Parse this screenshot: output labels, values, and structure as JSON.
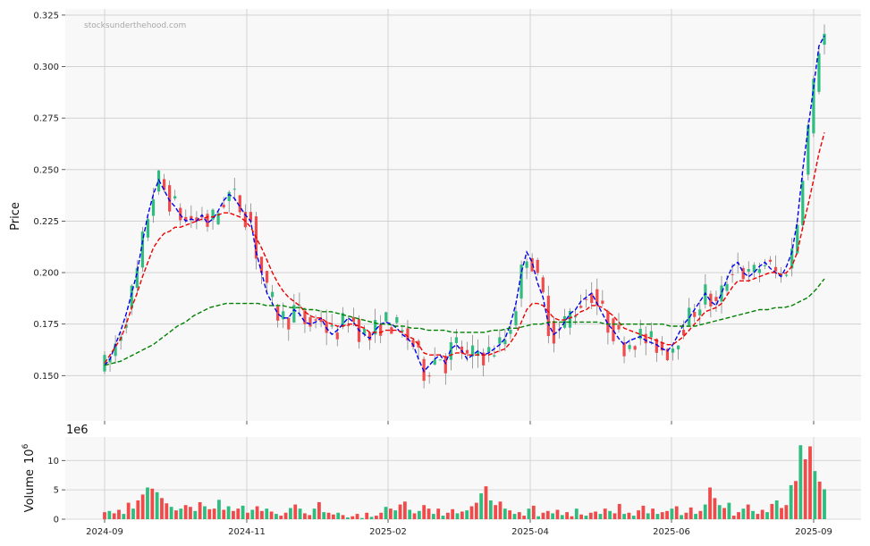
{
  "watermark": "stocksunderthehood.com",
  "chart_data": [
    {
      "type": "candlestick",
      "ylabel": "Price",
      "ylim": [
        0.128,
        0.328
      ],
      "yticks": [
        "0.150",
        "0.175",
        "0.200",
        "0.225",
        "0.250",
        "0.275",
        "0.300",
        "0.325"
      ],
      "xticks": [
        "2024-09",
        "2024-11",
        "2025-02",
        "2025-04",
        "2025-06",
        "2025-09"
      ],
      "grid": true,
      "colors": {
        "up": "#2ebd7f",
        "down": "#f04a4a",
        "ma_short": "#0000ee",
        "ma_mid": "#ee0000",
        "ma_long": "#008000",
        "panel_bg": "#f8f8f8",
        "grid": "#cccccc"
      },
      "series": [
        {
          "values": [
            0.155,
            0.158,
            0.165,
            0.172,
            0.18,
            0.19,
            0.2,
            0.215,
            0.228,
            0.238,
            0.245,
            0.24,
            0.235,
            0.232,
            0.228,
            0.225,
            0.226,
            0.225,
            0.228,
            0.224,
            0.226,
            0.23,
            0.235,
            0.238,
            0.236,
            0.232,
            0.228,
            0.225,
            0.21,
            0.2,
            0.19,
            0.185,
            0.18,
            0.178,
            0.178,
            0.182,
            0.18,
            0.176,
            0.175,
            0.176,
            0.178,
            0.173,
            0.17,
            0.172,
            0.175,
            0.178,
            0.176,
            0.172,
            0.17,
            0.168,
            0.172,
            0.175,
            0.176,
            0.175,
            0.173,
            0.17,
            0.168,
            0.165,
            0.158,
            0.152,
            0.155,
            0.158,
            0.16,
            0.156,
            0.163,
            0.165,
            0.162,
            0.158,
            0.16,
            0.162,
            0.16,
            0.161,
            0.163,
            0.165,
            0.168,
            0.175,
            0.185,
            0.2,
            0.21,
            0.205,
            0.195,
            0.188,
            0.175,
            0.17,
            0.172,
            0.176,
            0.18,
            0.182,
            0.186,
            0.188,
            0.19,
            0.185,
            0.18,
            0.175,
            0.172,
            0.168,
            0.165,
            0.167,
            0.168,
            0.169,
            0.167,
            0.166,
            0.165,
            0.163,
            0.162,
            0.165,
            0.17,
            0.175,
            0.178,
            0.182,
            0.186,
            0.19,
            0.186,
            0.184,
            0.19,
            0.197,
            0.203,
            0.205,
            0.2,
            0.198,
            0.2,
            0.203,
            0.205,
            0.202,
            0.2,
            0.198,
            0.203,
            0.21,
            0.225,
            0.25,
            0.27,
            0.29,
            0.31,
            0.315
          ],
          "name": ""
        },
        {
          "values": [
            0.156,
            0.16,
            0.164,
            0.168,
            0.175,
            0.183,
            0.19,
            0.198,
            0.205,
            0.212,
            0.216,
            0.219,
            0.22,
            0.222,
            0.222,
            0.223,
            0.224,
            0.225,
            0.226,
            0.227,
            0.227,
            0.228,
            0.229,
            0.229,
            0.228,
            0.227,
            0.225,
            0.222,
            0.217,
            0.212,
            0.206,
            0.2,
            0.195,
            0.191,
            0.188,
            0.186,
            0.184,
            0.181,
            0.179,
            0.178,
            0.178,
            0.176,
            0.175,
            0.174,
            0.174,
            0.175,
            0.175,
            0.174,
            0.173,
            0.171,
            0.171,
            0.171,
            0.172,
            0.172,
            0.172,
            0.171,
            0.169,
            0.168,
            0.165,
            0.161,
            0.16,
            0.16,
            0.16,
            0.159,
            0.16,
            0.161,
            0.161,
            0.16,
            0.16,
            0.16,
            0.16,
            0.16,
            0.161,
            0.162,
            0.163,
            0.166,
            0.17,
            0.176,
            0.182,
            0.185,
            0.185,
            0.184,
            0.181,
            0.178,
            0.177,
            0.177,
            0.178,
            0.179,
            0.181,
            0.182,
            0.184,
            0.184,
            0.183,
            0.181,
            0.179,
            0.176,
            0.173,
            0.172,
            0.171,
            0.17,
            0.169,
            0.168,
            0.167,
            0.166,
            0.165,
            0.165,
            0.167,
            0.169,
            0.172,
            0.175,
            0.178,
            0.181,
            0.182,
            0.183,
            0.185,
            0.189,
            0.193,
            0.196,
            0.196,
            0.196,
            0.197,
            0.198,
            0.199,
            0.2,
            0.2,
            0.199,
            0.2,
            0.203,
            0.21,
            0.222,
            0.233,
            0.245,
            0.258,
            0.268
          ],
          "name": ""
        },
        {
          "values": [
            0.155,
            0.156,
            0.157,
            0.159,
            0.161,
            0.163,
            0.165,
            0.168,
            0.171,
            0.174,
            0.176,
            0.179,
            0.181,
            0.183,
            0.184,
            0.185,
            0.185,
            0.185,
            0.185,
            0.185,
            0.184,
            0.184,
            0.184,
            0.183,
            0.183,
            0.182,
            0.182,
            0.181,
            0.181,
            0.18,
            0.179,
            0.178,
            0.177,
            0.176,
            0.175,
            0.175,
            0.174,
            0.174,
            0.173,
            0.173,
            0.172,
            0.172,
            0.172,
            0.171,
            0.171,
            0.171,
            0.171,
            0.171,
            0.172,
            0.172,
            0.173,
            0.173,
            0.174,
            0.175,
            0.175,
            0.176,
            0.176,
            0.176,
            0.176,
            0.176,
            0.176,
            0.176,
            0.175,
            0.175,
            0.175,
            0.175,
            0.175,
            0.175,
            0.175,
            0.175,
            0.174,
            0.174,
            0.174,
            0.174,
            0.175,
            0.176,
            0.177,
            0.178,
            0.179,
            0.18,
            0.181,
            0.182,
            0.182,
            0.183,
            0.183,
            0.184,
            0.186,
            0.188,
            0.192,
            0.197
          ],
          "name": ""
        }
      ]
    },
    {
      "type": "bar",
      "ylabel": "Volume",
      "scale_label": "1e6",
      "unit_label": "10",
      "unit_exp": "6",
      "ylim": [
        0,
        14
      ],
      "yticks": [
        "0",
        "5",
        "10"
      ],
      "xticks": [
        "2024-09",
        "2024-11",
        "2025-02",
        "2025-04",
        "2025-06",
        "2025-09"
      ],
      "grid": true,
      "values": [
        1.2,
        1.4,
        1.0,
        1.6,
        0.9,
        2.8,
        1.8,
        3.2,
        4.2,
        5.4,
        5.2,
        4.6,
        3.6,
        2.7,
        2.1,
        1.5,
        1.8,
        2.4,
        2.1,
        1.4,
        2.9,
        2.2,
        1.7,
        1.8,
        3.3,
        1.6,
        2.2,
        1.4,
        1.8,
        2.3,
        1.1,
        1.6,
        2.2,
        1.4,
        1.8,
        1.3,
        0.9,
        0.6,
        1.1,
        1.9,
        2.5,
        1.8,
        1.0,
        0.7,
        1.8,
        2.9,
        1.2,
        1.1,
        0.8,
        1.1,
        0.7,
        0.3,
        0.5,
        0.9,
        0.2,
        1.1,
        0.4,
        0.6,
        1.1,
        2.1,
        1.8,
        1.5,
        2.5,
        3.0,
        1.6,
        1.0,
        1.4,
        2.4,
        1.8,
        0.9,
        1.8,
        0.6,
        1.1,
        1.7,
        1.0,
        1.3,
        1.5,
        2.2,
        2.8,
        4.4,
        5.6,
        3.2,
        2.4,
        3.0,
        1.8,
        1.5,
        0.9,
        1.2,
        0.6,
        1.8,
        2.3,
        0.5,
        1.1,
        1.4,
        1.0,
        1.6,
        0.7,
        1.2,
        0.5,
        1.8,
        0.8,
        0.6,
        1.1,
        1.3,
        0.9,
        1.8,
        1.4,
        1.0,
        2.6,
        0.9,
        1.1,
        0.6,
        1.5,
        2.3,
        1.0,
        1.8,
        0.9,
        1.2,
        1.4,
        1.8,
        2.2,
        0.7,
        1.1,
        2.0,
        0.9,
        1.4,
        2.5,
        5.4,
        3.6,
        2.4,
        1.9,
        2.8,
        0.6,
        1.2,
        1.8,
        2.5,
        1.4,
        0.9,
        1.6,
        1.2,
        2.6,
        3.2,
        1.9,
        2.4,
        5.8,
        6.5,
        12.6,
        10.2,
        12.4,
        8.2,
        6.4,
        5.1
      ]
    }
  ]
}
